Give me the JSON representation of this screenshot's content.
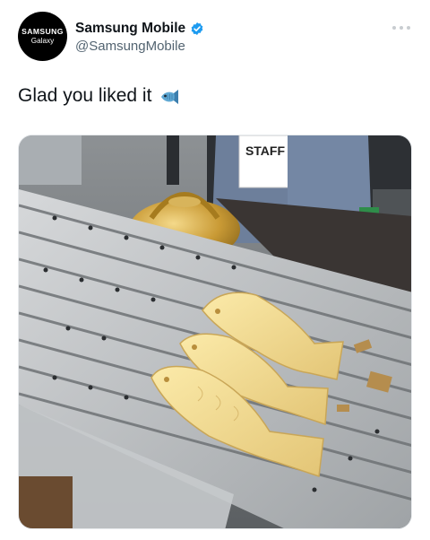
{
  "account": {
    "avatar_brand": "SAMSUNG",
    "avatar_sub": "Galaxy",
    "display_name": "Samsung Mobile",
    "handle": "@SamsungMobile",
    "verified": true
  },
  "tweet": {
    "text": "Glad you liked it",
    "emoji": "fish-emoji"
  },
  "photo": {
    "sign_text": "STAFF"
  },
  "colors": {
    "verified_blue": "#1d9bf0",
    "text_primary": "#0f1419",
    "text_secondary": "#536471"
  },
  "icons": [
    "verified-badge-icon",
    "more-options-icon",
    "fish-emoji"
  ]
}
